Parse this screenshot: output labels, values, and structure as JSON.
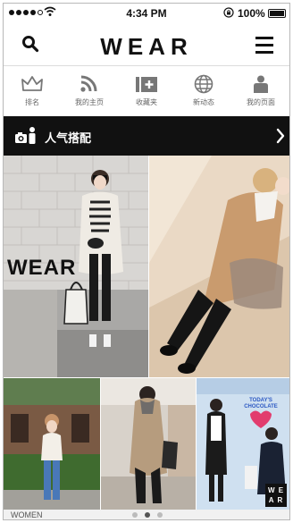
{
  "status_bar": {
    "time": "4:34 PM",
    "battery": "100%",
    "signal_bars_filled": 4,
    "signal_bars_total": 5
  },
  "header": {
    "logo": "WEAR",
    "search_icon": "search-icon",
    "menu_icon": "hamburger-menu-icon"
  },
  "nav": {
    "items": [
      {
        "label": "排名",
        "icon": "crown-icon"
      },
      {
        "label": "我的主页",
        "icon": "rss-feed-icon"
      },
      {
        "label": "收藏夹",
        "icon": "add-to-collection-icon"
      },
      {
        "label": "新动态",
        "icon": "globe-icon"
      },
      {
        "label": "我的页面",
        "icon": "person-icon"
      }
    ]
  },
  "section": {
    "title": "人气搭配",
    "icon": "camera-person-icon",
    "chevron": "chevron-right-icon"
  },
  "photos": {
    "overlay_text": "WEAR",
    "badge_text": "WEAR",
    "sign_text": "TODAY'S CHOCOLATE"
  },
  "footer": {
    "label": "WOMEN",
    "page_count": 3,
    "active_page": 2
  },
  "colors": {
    "text": "#111111",
    "muted": "#666666",
    "section_bar": "#111111",
    "divider": "#dcdcdc"
  }
}
